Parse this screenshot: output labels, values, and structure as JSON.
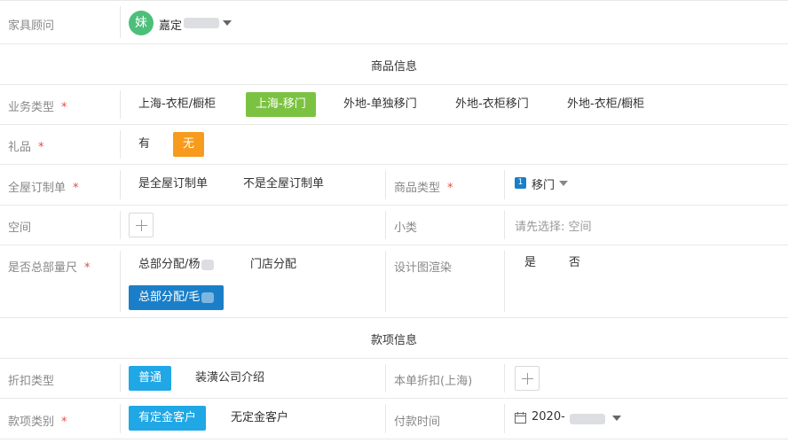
{
  "advisor": {
    "label": "家具顾问",
    "avatar_char": "妹",
    "name": "嘉定",
    "avatar_color": "#4cbf7a"
  },
  "sections": {
    "product": "商品信息",
    "payment": "款项信息"
  },
  "business_type": {
    "label": "业务类型",
    "required": "*",
    "options": [
      "上海-衣柜/橱柜",
      "上海-移门",
      "外地-单独移门",
      "外地-衣柜移门",
      "外地-衣柜/橱柜"
    ],
    "selected": "上海-移门"
  },
  "gift": {
    "label": "礼品",
    "required": "*",
    "options": [
      "有",
      "无"
    ],
    "selected": "无"
  },
  "whole_house": {
    "label": "全屋订制单",
    "required": "*",
    "options": [
      "是全屋订制单",
      "不是全屋订制单"
    ]
  },
  "product_type": {
    "label": "商品类型",
    "required": "*",
    "badge": "1",
    "value": "移门"
  },
  "space": {
    "label": "空间"
  },
  "subcategory": {
    "label": "小类",
    "placeholder": "请先选择: 空间"
  },
  "hq_measure": {
    "label": "是否总部量尺",
    "required": "*",
    "options": [
      "总部分配/杨",
      "门店分配",
      "总部分配/毛"
    ],
    "selected": "总部分配/毛"
  },
  "design_render": {
    "label": "设计图渲染",
    "options": [
      "是",
      "否"
    ]
  },
  "discount_type": {
    "label": "折扣类型",
    "options": [
      "普通",
      "装潢公司介绍"
    ],
    "selected": "普通"
  },
  "order_discount": {
    "label": "本单折扣(上海)"
  },
  "payment_category": {
    "label": "款项类别",
    "required": "*",
    "options": [
      "有定金客户",
      "无定金客户"
    ],
    "selected": "有定金客户"
  },
  "payment_time": {
    "label": "付款时间",
    "value": "2020-"
  },
  "colors": {
    "green": "#7cc242",
    "orange": "#f79b1e",
    "blue": "#1fa7e6",
    "dark_blue": "#1a7fc8",
    "required": "#e54d42"
  }
}
